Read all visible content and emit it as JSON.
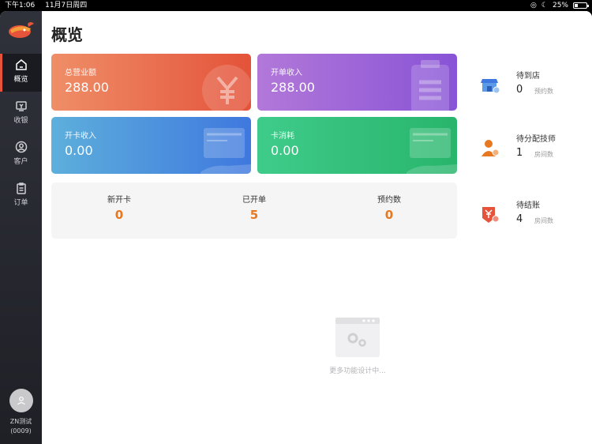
{
  "statusbar": {
    "time": "下午1:06",
    "date": "11月7日周四",
    "battery": "25%"
  },
  "sidebar": {
    "items": [
      {
        "label": "概览",
        "icon": "home-icon",
        "active": true
      },
      {
        "label": "收银",
        "icon": "cash-register-icon",
        "active": false
      },
      {
        "label": "客户",
        "icon": "user-circle-icon",
        "active": false
      },
      {
        "label": "订单",
        "icon": "clipboard-icon",
        "active": false
      }
    ],
    "user": {
      "name": "ZN测试",
      "code": "(0009)"
    }
  },
  "page": {
    "title": "概览"
  },
  "cards": [
    {
      "label": "总营业额",
      "value": "288.00",
      "icon": "yen-icon",
      "color": "#e4533a"
    },
    {
      "label": "开单收入",
      "value": "288.00",
      "icon": "clipboard-list-icon",
      "color": "#8853d6"
    },
    {
      "label": "开卡收入",
      "value": "0.00",
      "icon": "card-icon",
      "color": "#3f78de"
    },
    {
      "label": "卡消耗",
      "value": "0.00",
      "icon": "card-icon",
      "color": "#28b56b"
    }
  ],
  "stats": [
    {
      "label": "新开卡",
      "value": "0"
    },
    {
      "label": "已开单",
      "value": "5"
    },
    {
      "label": "预约数",
      "value": "0"
    }
  ],
  "pending": [
    {
      "label": "待到店",
      "value": "0",
      "unit": "预约数",
      "icon": "store-icon"
    },
    {
      "label": "待分配技师",
      "value": "1",
      "unit": "房间数",
      "icon": "technician-icon"
    },
    {
      "label": "待结账",
      "value": "4",
      "unit": "房间数",
      "icon": "bill-icon"
    }
  ],
  "empty": {
    "text": "更多功能设计中..."
  }
}
